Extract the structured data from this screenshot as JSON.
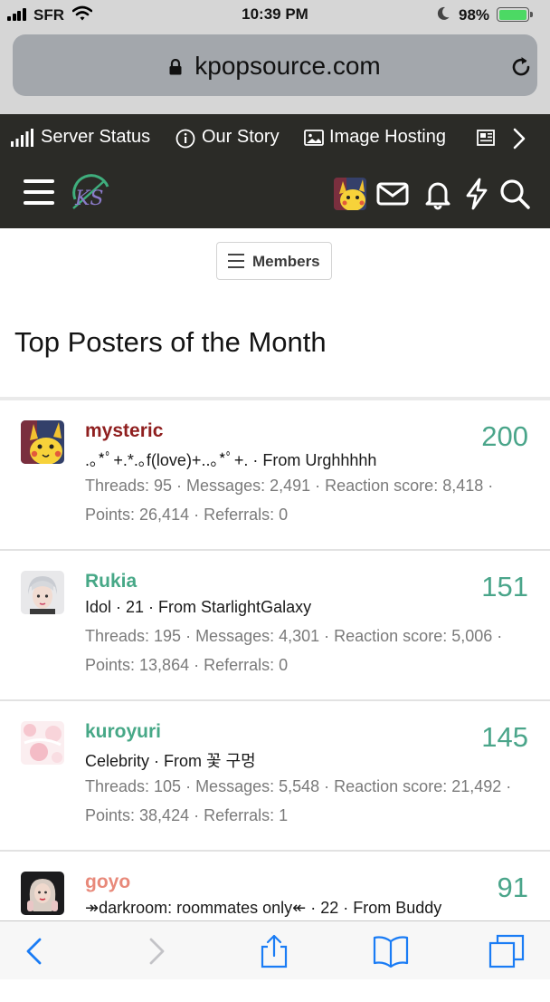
{
  "status_bar": {
    "carrier": "SFR",
    "time": "10:39 PM",
    "battery_percent": "98%",
    "battery_level": 0.98,
    "icons": [
      "signal-icon",
      "wifi-icon",
      "moon-icon",
      "battery-icon"
    ]
  },
  "browser": {
    "url": "kpopsource.com",
    "icons": [
      "lock-icon",
      "reload-icon"
    ],
    "toolbar_icons": [
      "back-icon",
      "forward-icon",
      "share-icon",
      "bookmarks-icon",
      "tabs-icon"
    ]
  },
  "site_nav": {
    "links": [
      {
        "label": "Server Status",
        "icon": "signal-bars-icon"
      },
      {
        "label": "Our Story",
        "icon": "info-icon"
      },
      {
        "label": "Image Hosting",
        "icon": "image-icon"
      }
    ],
    "icons": [
      "menu-icon",
      "logo",
      "avatar",
      "mail-icon",
      "bell-icon",
      "bolt-icon",
      "search-icon"
    ]
  },
  "members_button": {
    "label": "Members"
  },
  "page_title": "Top Posters of the Month",
  "members": [
    {
      "name": "mysteric",
      "name_color": "#8f1f1f",
      "count": "200",
      "info": ".｡*ﾟ+.*.｡f(love)+..｡*ﾟ+. · From Urghhhhh",
      "stats1": "Threads: 95 · Messages: 2,491 · Reaction score: 8,418 ·",
      "stats2": "Points: 26,414 · Referrals: 0"
    },
    {
      "name": "Rukia",
      "name_color": "#47a887",
      "count": "151",
      "info": "Idol · 21 · From StarlightGalaxy",
      "stats1": "Threads: 195 · Messages: 4,301 · Reaction score: 5,006 ·",
      "stats2": "Points: 13,864 · Referrals: 0"
    },
    {
      "name": "kuroyuri",
      "name_color": "#47a887",
      "count": "145",
      "info": "Celebrity · From 꽃 구멍",
      "stats1": "Threads: 105 · Messages: 5,548 · Reaction score: 21,492 ·",
      "stats2": "Points: 38,424 · Referrals: 1"
    },
    {
      "name": "goyo",
      "name_color": "#e8897a",
      "count": "91",
      "info": "↠darkroom: roommates only↞ · 22 · From Buddy",
      "stats1": "",
      "stats2": ""
    }
  ],
  "colors": {
    "nav_bg": "#2b2b27",
    "count_green": "#4aa58a",
    "ios_blue": "#1a7cf5"
  }
}
